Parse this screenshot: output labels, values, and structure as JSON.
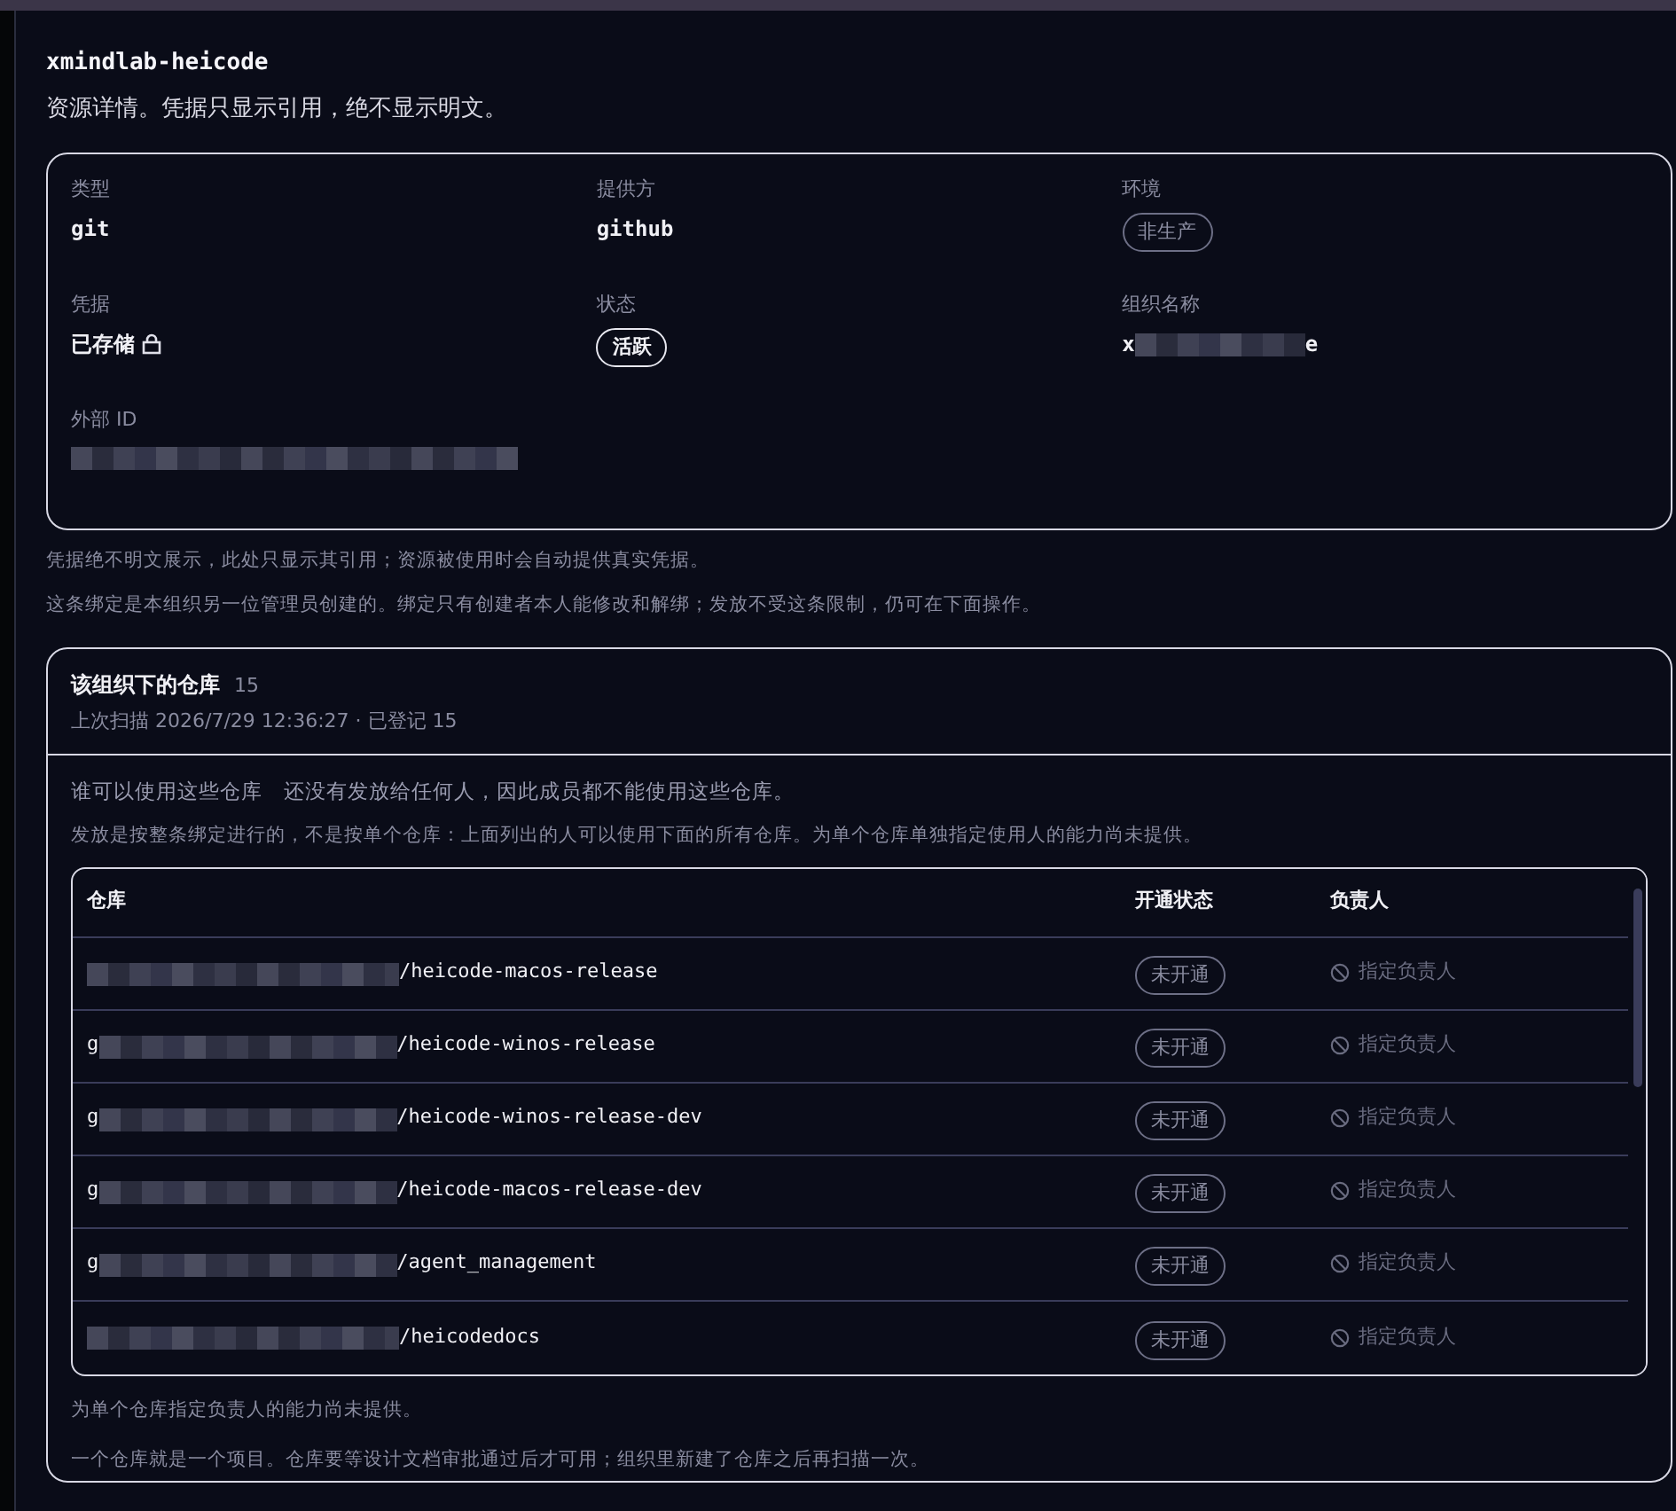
{
  "title": "xmindlab-heicode",
  "subtitle": "资源详情。凭据只显示引用，绝不显示明文。",
  "details": [
    {
      "label": "类型",
      "kind": "mono",
      "value": "git"
    },
    {
      "label": "提供方",
      "kind": "mono",
      "value": "github"
    },
    {
      "label": "环境",
      "kind": "badge",
      "value": "非生产",
      "emphasis": false
    },
    {
      "label": "凭据",
      "kind": "locked",
      "value": "已存储"
    },
    {
      "label": "状态",
      "kind": "badge",
      "value": "活跃",
      "emphasis": true
    },
    {
      "label": "组织名称",
      "kind": "redacted",
      "prefix": "x",
      "suffix": "e"
    },
    {
      "label": "外部 ID",
      "kind": "redacted"
    }
  ],
  "notes": [
    "凭据绝不明文展示，此处只显示其引用；资源被使用时会自动提供真实凭据。",
    "这条绑定是本组织另一位管理员创建的。绑定只有创建者本人能修改和解绑；发放不受这条限制，仍可在下面操作。"
  ],
  "repos": {
    "title": "该组织下的仓库",
    "count": "15",
    "scan": "上次扫描 2026/7/29 12:36:27 · 已登记 15",
    "access_label": "谁可以使用这些仓库",
    "access_text": "还没有发放给任何人，因此成员都不能使用这些仓库。",
    "hint": "发放是按整条绑定进行的，不是按单个仓库：上面列出的人可以使用下面的所有仓库。为单个仓库单独指定使用人的能力尚未提供。",
    "columns": [
      "仓库",
      "开通状态",
      "负责人"
    ],
    "rows": [
      {
        "prefix": "",
        "path": "/heicode-macos-release",
        "status": "未开通",
        "owner": "指定负责人",
        "disabled": true
      },
      {
        "prefix": "g",
        "path": "/heicode-winos-release",
        "status": "未开通",
        "owner": "指定负责人",
        "disabled": true
      },
      {
        "prefix": "g",
        "path": "/heicode-winos-release-dev",
        "status": "未开通",
        "owner": "指定负责人",
        "disabled": true
      },
      {
        "prefix": "g",
        "path": "/heicode-macos-release-dev",
        "status": "未开通",
        "owner": "指定负责人",
        "disabled": true
      },
      {
        "prefix": "g",
        "path": "/agent_management",
        "status": "未开通",
        "owner": "指定负责人",
        "disabled": true
      },
      {
        "prefix": "",
        "path": "/heicodedocs",
        "status": "未开通",
        "owner": "指定负责人",
        "disabled": true
      }
    ],
    "footer": [
      "为单个仓库指定负责人的能力尚未提供。",
      "一个仓库就是一个项目。仓库要等设计文档审批通过后才可用；组织里新建了仓库之后再扫描一次。"
    ]
  }
}
